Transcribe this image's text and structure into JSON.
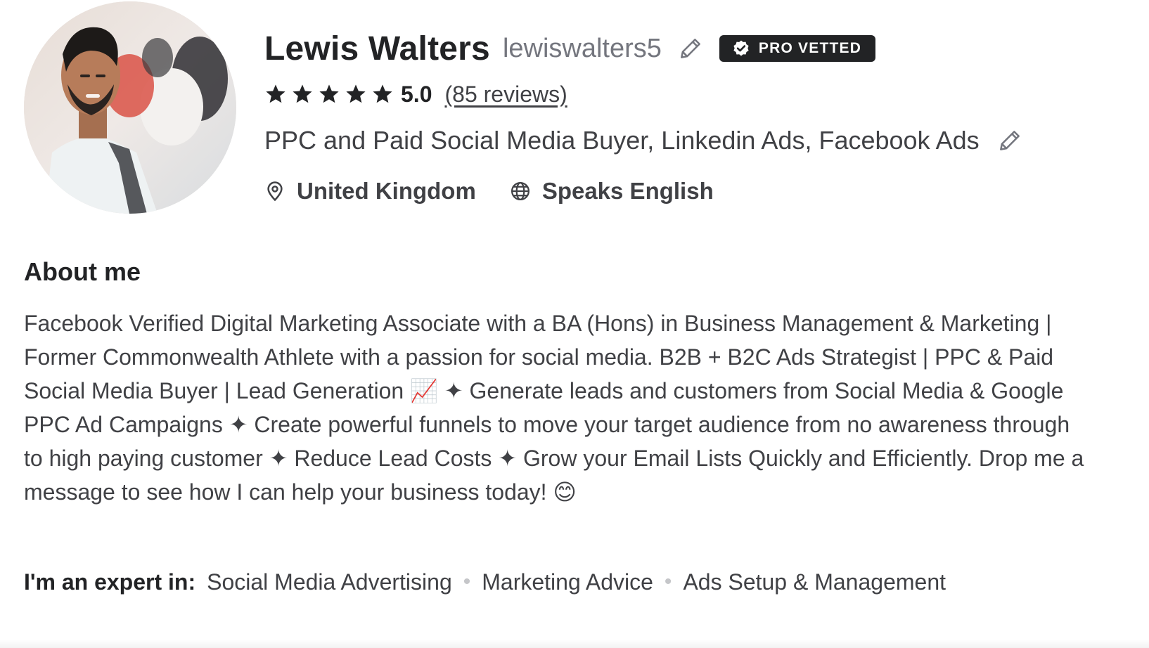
{
  "profile": {
    "name": "Lewis Walters",
    "username": "lewiswalters5",
    "badge": "PRO VETTED",
    "rating": "5.0",
    "stars": 5,
    "reviews": "(85 reviews)",
    "tagline": "PPC and Paid Social Media Buyer, Linkedin Ads, Facebook Ads",
    "location": "United Kingdom",
    "languages": "Speaks English"
  },
  "about": {
    "title": "About me",
    "text": "Facebook Verified Digital Marketing Associate with a BA (Hons) in Business Management & Marketing | Former Commonwealth Athlete with a passion for social media. B2B + B2C Ads Strategist | PPC & Paid Social Media Buyer | Lead Generation 📈 ✦ Generate leads and customers from Social Media & Google PPC Ad Campaigns ✦ Create powerful funnels to move your target audience from no awareness through to high paying customer ✦ Reduce Lead Costs ✦ Grow your Email Lists Quickly and Efficiently. Drop me a message to see how I can help your business today! 😊"
  },
  "expertise": {
    "label": "I'm an expert in:",
    "items": [
      "Social Media Advertising",
      "Marketing Advice",
      "Ads Setup & Management"
    ]
  },
  "icons": {
    "edit": "pencil-icon",
    "badge": "verified-check-icon",
    "star": "star-icon",
    "location": "location-pin-icon",
    "language": "globe-icon"
  },
  "colors": {
    "text_dark": "#222325",
    "text_body": "#404145",
    "text_muted": "#74767e",
    "badge_bg": "#222325"
  }
}
